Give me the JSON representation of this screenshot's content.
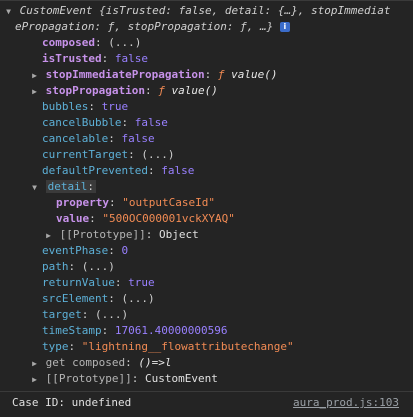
{
  "header": {
    "line1_italic": "CustomEvent {isTrusted: false, detail: {…}, stopImmediat",
    "line2_italic": "ePropagation: ƒ, stopPropagation: ƒ, …}",
    "info_badge": "i"
  },
  "props": [
    {
      "key": "composed",
      "sep": ": ",
      "value": "(...)"
    },
    {
      "key": "isTrusted",
      "sep": ": ",
      "value": "false"
    },
    {
      "key": "stopImmediatePropagation",
      "sep": ": ",
      "fsym": "ƒ",
      "value": "value()"
    },
    {
      "key": "stopPropagation",
      "sep": ": ",
      "fsym": "ƒ",
      "value": "value()"
    },
    {
      "key": "bubbles",
      "sep": ": ",
      "value": "true"
    },
    {
      "key": "cancelBubble",
      "sep": ": ",
      "value": "false"
    },
    {
      "key": "cancelable",
      "sep": ": ",
      "value": "false"
    },
    {
      "key": "currentTarget",
      "sep": ": ",
      "value": "(...)"
    },
    {
      "key": "defaultPrevented",
      "sep": ": ",
      "value": "false"
    },
    {
      "key": "detail",
      "sep": ":"
    },
    {
      "key": "property",
      "sep": ": ",
      "value": "\"outputCaseId\""
    },
    {
      "key": "value",
      "sep": ": ",
      "value": "\"500OC000001vckXYAQ\""
    },
    {
      "key": "[[Prototype]]",
      "sep": ": ",
      "value": "Object"
    },
    {
      "key": "eventPhase",
      "sep": ": ",
      "value": "0"
    },
    {
      "key": "path",
      "sep": ": ",
      "value": "(...)"
    },
    {
      "key": "returnValue",
      "sep": ": ",
      "value": "true"
    },
    {
      "key": "srcElement",
      "sep": ": ",
      "value": "(...)"
    },
    {
      "key": "target",
      "sep": ": ",
      "value": "(...)"
    },
    {
      "key": "timeStamp",
      "sep": ": ",
      "value": "17061.40000000596"
    },
    {
      "key": "type",
      "sep": ": ",
      "value": "\"lightning__flowattributechange\""
    },
    {
      "key": "get composed",
      "sep": ": ",
      "value": "()=>l"
    },
    {
      "key": "[[Prototype]]",
      "sep": ": ",
      "value": "CustomEvent"
    }
  ],
  "footer": {
    "case_id_text": "Case ID: undefined",
    "source_link": "aura_prod.js:103"
  }
}
